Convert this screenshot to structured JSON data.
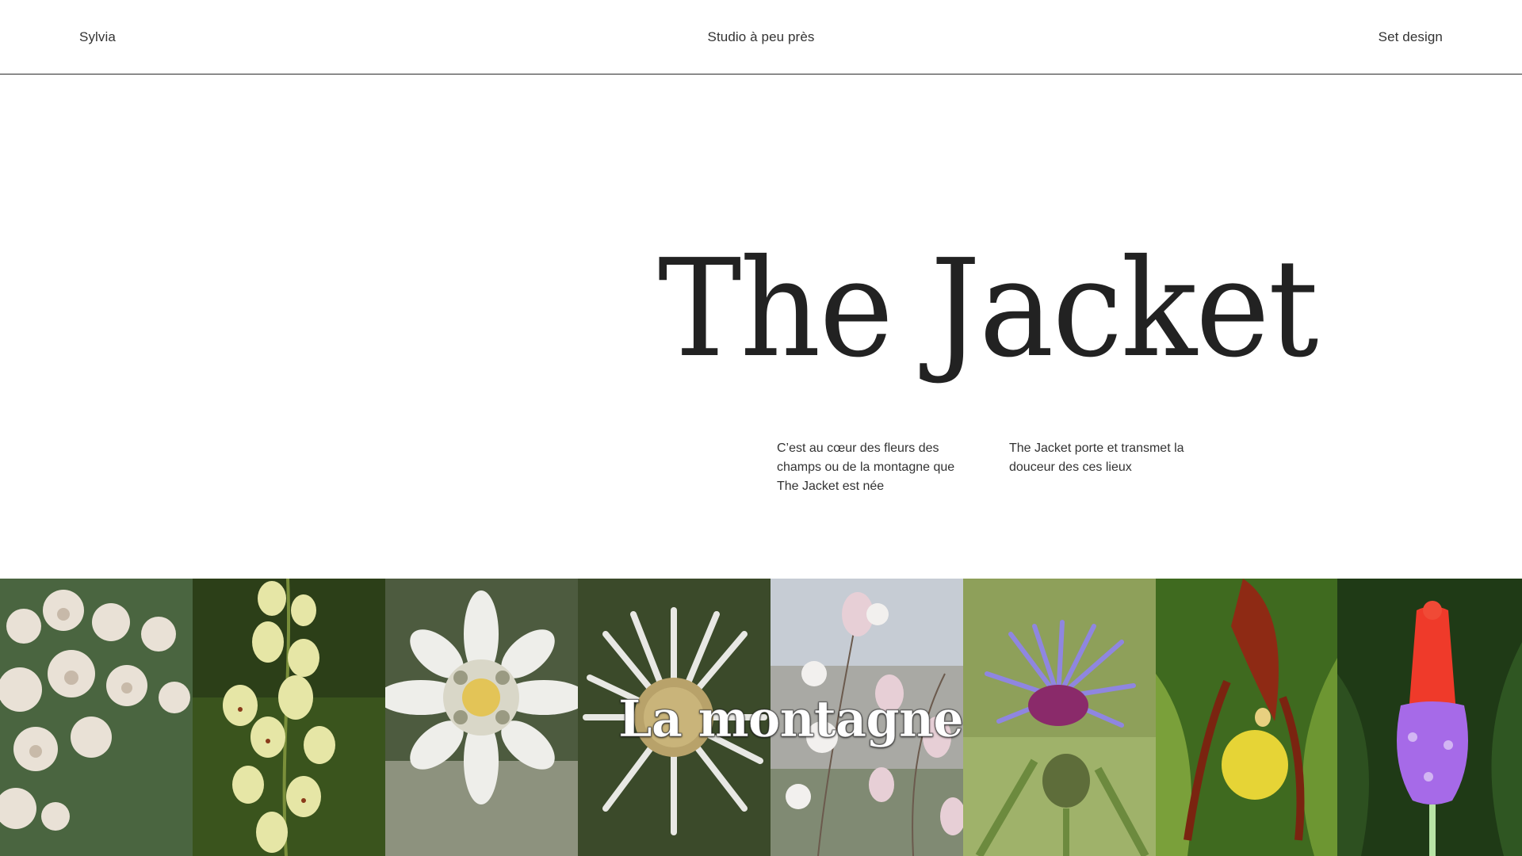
{
  "header": {
    "left_link": "Sylvia",
    "center_link": "Studio à peu près",
    "right_link": "Set design"
  },
  "hero": {
    "title": "The Jacket",
    "paragraph_1": "C’est au cœur des fleurs des champs ou de la montagne que The Jacket est née",
    "paragraph_2": "The Jacket porte et transmet la douceur des ces lieux"
  },
  "gallery": {
    "label": "La montagne",
    "images": [
      "yarrow-flowers-image",
      "foxglove-flowers-image",
      "edelweiss-flower-image",
      "carline-thistle-image",
      "campion-flowers-image",
      "knapweed-flower-image",
      "ladys-slipper-orchid-image",
      "vial-primrose-image"
    ]
  },
  "colors": {
    "text": "#2a2a2a",
    "background": "#ffffff",
    "divider": "#2a2a2a"
  }
}
